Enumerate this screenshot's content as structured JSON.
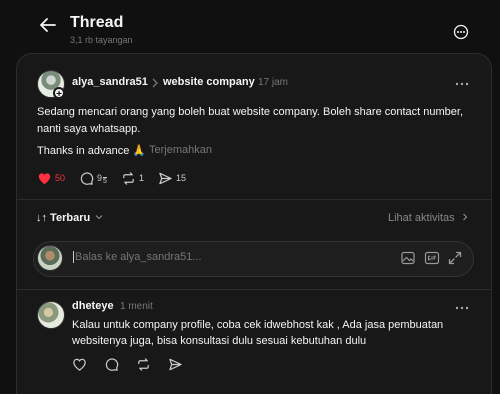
{
  "header": {
    "title": "Thread",
    "views": "3,1 rb tayangan"
  },
  "post": {
    "author": "alya_sandra51",
    "separator": ">",
    "topic": "website company",
    "time": "17 jam",
    "text": "Sedang mencari orang yang boleh buat website company. Boleh share contact number, nanti saya whatsapp.",
    "thanks": "Thanks in advance 🙏",
    "translate": "Terjemahkan",
    "likes": "50",
    "comments": "9",
    "comments_sub": "5",
    "reposts": "1",
    "shares": "15"
  },
  "sort": {
    "label": "↓↑ Terbaru",
    "activity": "Lihat aktivitas"
  },
  "reply": {
    "placeholder": "Balas ke alya_sandra51..."
  },
  "comment": {
    "author": "dheteye",
    "time": "1 menit",
    "text": "Kalau untuk company profile, coba cek idwebhost kak , Ada jasa pembuatan websitenya juga, bisa konsultasi dulu sesuai kebutuhan dulu"
  },
  "colors": {
    "background": "#101010",
    "card": "#181818",
    "like_red": "#ff3040",
    "muted": "#777777"
  }
}
